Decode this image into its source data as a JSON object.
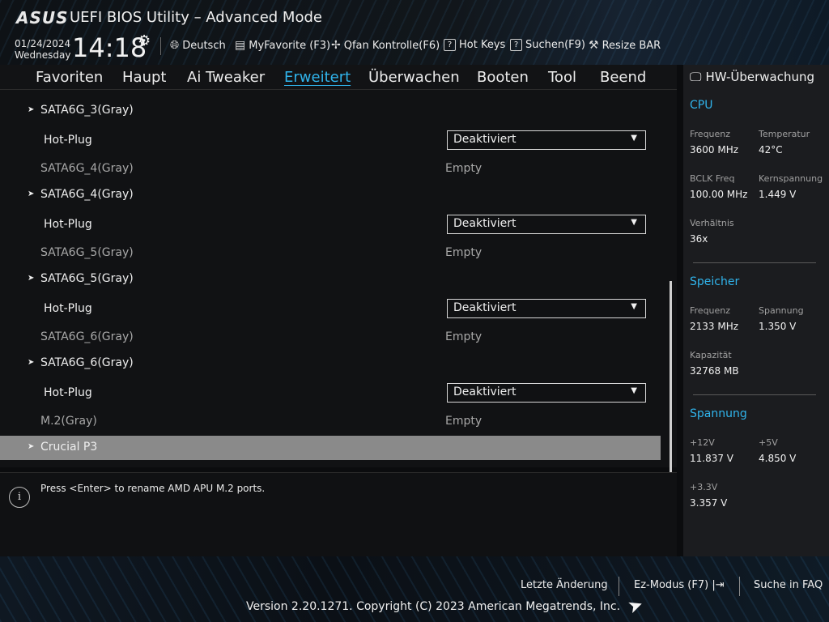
{
  "header": {
    "logo": "ASUS",
    "title": "UEFI BIOS Utility – Advanced Mode",
    "date": "01/24/2024",
    "weekday": "Wednesday",
    "time": "14:18",
    "items": [
      {
        "label": "Deutsch",
        "icon": "globe-icon"
      },
      {
        "label": "MyFavorite (F3)",
        "icon": "favorite-icon"
      },
      {
        "label": "Qfan Kontrolle(F6)",
        "icon": "fan-icon"
      },
      {
        "label": "Hot Keys",
        "icon": "help-box-icon"
      },
      {
        "label": "Suchen(F9)",
        "icon": "search-box-icon"
      },
      {
        "label": "Resize BAR",
        "icon": "resize-bar-icon"
      }
    ]
  },
  "menu": {
    "tabs": [
      "Favoriten",
      "Haupt",
      "Ai Tweaker",
      "Erweitert",
      "Überwachen",
      "Booten",
      "Tool",
      "Beend"
    ],
    "active": "Erweitert"
  },
  "list": {
    "rows": [
      {
        "label": "SATA6G_3(Gray)"
      },
      {
        "label": "Hot-Plug",
        "value": "Deaktiviert"
      },
      {
        "label": "SATA6G_4(Gray)",
        "value": "Empty"
      },
      {
        "label": "SATA6G_4(Gray)"
      },
      {
        "label": "Hot-Plug",
        "value": "Deaktiviert"
      },
      {
        "label": "SATA6G_5(Gray)",
        "value": "Empty"
      },
      {
        "label": "SATA6G_5(Gray)"
      },
      {
        "label": "Hot-Plug",
        "value": "Deaktiviert"
      },
      {
        "label": "SATA6G_6(Gray)",
        "value": "Empty"
      },
      {
        "label": "SATA6G_6(Gray)"
      },
      {
        "label": "Hot-Plug",
        "value": "Deaktiviert"
      },
      {
        "label": "M.2(Gray)",
        "value": "Empty"
      },
      {
        "label": "Crucial P3"
      }
    ]
  },
  "help": {
    "icon": "info-icon",
    "text": "Press <Enter> to rename AMD APU M.2 ports."
  },
  "hw": {
    "title": "HW-Überwachung",
    "cpu": {
      "section": "CPU",
      "freq_label": "Frequenz",
      "freq": "3600 MHz",
      "temp_label": "Temperatur",
      "temp": "42°C",
      "bclk_label": "BCLK Freq",
      "bclk": "100.00 MHz",
      "core_label": "Kernspannung",
      "core": "1.449 V",
      "ratio_label": "Verhältnis",
      "ratio": "36x"
    },
    "memory": {
      "section": "Speicher",
      "freq_label": "Frequenz",
      "freq": "2133 MHz",
      "volt_label": "Spannung",
      "volt": "1.350 V",
      "cap_label": "Kapazität",
      "cap": "32768 MB"
    },
    "voltage": {
      "section": "Spannung",
      "v12_label": "+12V",
      "v12": "11.837 V",
      "v5_label": "+5V",
      "v5": "4.850 V",
      "v33_label": "+3.3V",
      "v33": "3.357 V"
    }
  },
  "footer": {
    "last_change": "Letzte Änderung",
    "ez_mode": "Ez-Modus (F7)",
    "faq": "Suche in FAQ",
    "version": "Version 2.20.1271. Copyright (C) 2023 American Megatrends, Inc."
  }
}
